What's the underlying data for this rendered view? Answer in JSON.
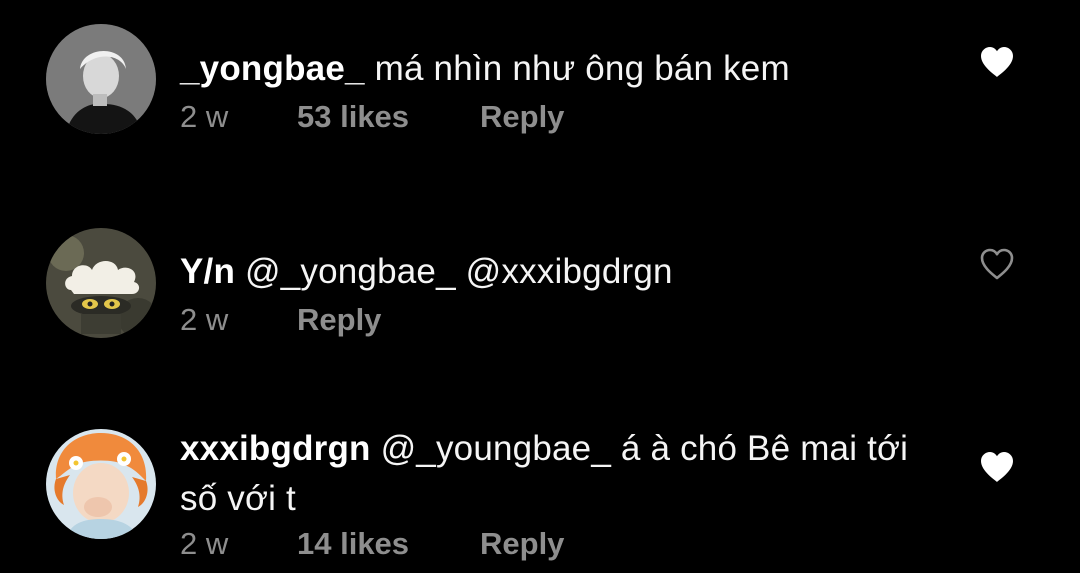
{
  "comments": [
    {
      "username": "_yongbae_",
      "text": "má nhìn như ông bán kem",
      "time": "2 w",
      "likes": "53 likes",
      "reply_label": "Reply",
      "liked": true,
      "avatar_icon": "avatar-grayscale-portrait"
    },
    {
      "username": "Y/n",
      "text": "@_yongbae_ @xxxibgdrgn",
      "time": "2 w",
      "likes": "",
      "reply_label": "Reply",
      "liked": false,
      "avatar_icon": "avatar-cloud-character"
    },
    {
      "username": "xxxibgdrgn",
      "text": "@_youngbae_ á à chó Bê mai tới số với t",
      "time": "2 w",
      "likes": "14 likes",
      "reply_label": "Reply",
      "liked": true,
      "avatar_icon": "avatar-orange-hair-flowers"
    }
  ],
  "colors": {
    "background": "#000000",
    "primary_text": "#f5f5f5",
    "secondary_text": "#8e8e8e",
    "heart_filled": "#ffffff",
    "heart_outline": "#8e8e8e"
  },
  "icons": {
    "heart_filled": "heart-filled-icon",
    "heart_outline": "heart-outline-icon"
  }
}
